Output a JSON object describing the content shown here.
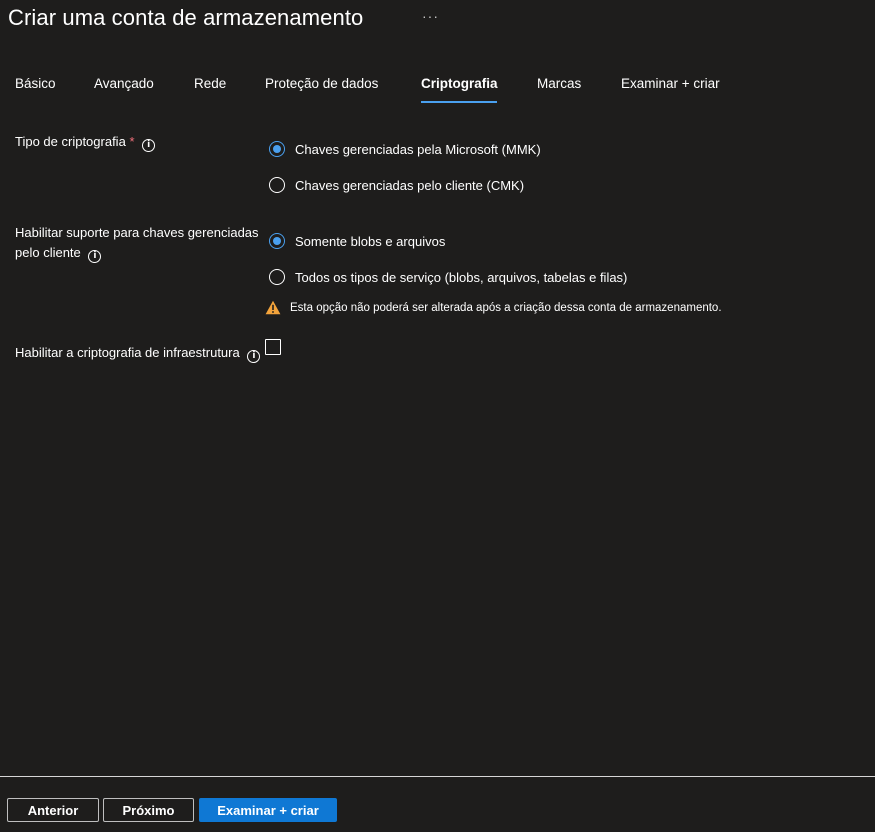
{
  "header": {
    "title": "Criar uma conta de armazenamento",
    "more_glyph": "···"
  },
  "tabs": [
    {
      "label": "Básico",
      "active": false
    },
    {
      "label": "Avançado",
      "active": false
    },
    {
      "label": "Rede",
      "active": false
    },
    {
      "label": "Proteção de dados",
      "active": false
    },
    {
      "label": "Criptografia",
      "active": true
    },
    {
      "label": "Marcas",
      "active": false
    },
    {
      "label": "Examinar + criar",
      "active": false
    }
  ],
  "encryption_type": {
    "label": "Tipo de criptografia",
    "required_mark": "*",
    "options": [
      {
        "label": "Chaves gerenciadas pela Microsoft (MMK)",
        "selected": true
      },
      {
        "label": "Chaves gerenciadas pelo cliente (CMK)",
        "selected": false
      }
    ]
  },
  "cmk_support": {
    "label_line1": "Habilitar suporte para chaves gerenciadas",
    "label_line2": "pelo cliente",
    "options": [
      {
        "label": "Somente blobs e arquivos",
        "selected": true
      },
      {
        "label": "Todos os tipos de serviço (blobs, arquivos, tabelas e filas)",
        "selected": false
      }
    ],
    "warning": "Esta opção não poderá ser alterada após a criação dessa conta de armazenamento."
  },
  "infrastructure_encryption": {
    "label": "Habilitar a criptografia de infraestrutura",
    "checked": false
  },
  "footer": {
    "previous": "Anterior",
    "next": "Próximo",
    "review_create": "Examinar + criar"
  },
  "colors": {
    "background": "#1e1d1c",
    "accent": "#4aa0ef",
    "primary_button": "#0f78d4",
    "required": "#f1707b",
    "warning": "#f3a33b"
  },
  "icons": {
    "info": "info-icon",
    "warning": "warning-icon",
    "more": "more-icon"
  }
}
